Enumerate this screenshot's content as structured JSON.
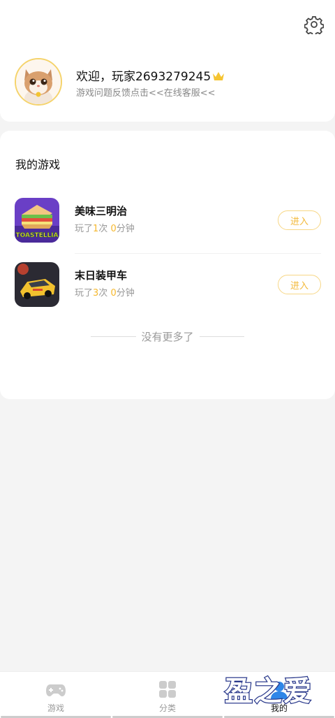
{
  "profile": {
    "welcome": "欢迎，玩家2693279245",
    "feedback": "游戏问题反馈点击<<在线客服<<"
  },
  "my_games": {
    "title": "我的游戏",
    "items": [
      {
        "name": "美味三明治",
        "played_prefix": "玩了",
        "play_count": "1",
        "count_unit": "次",
        "minutes": "0",
        "minutes_unit": "分钟",
        "button": "进入",
        "icon": "sandwich-game-icon",
        "icon_text": "TOASTELLIA"
      },
      {
        "name": "末日装甲车",
        "played_prefix": "玩了",
        "play_count": "3",
        "count_unit": "次",
        "minutes": "0",
        "minutes_unit": "分钟",
        "button": "进入",
        "icon": "armored-car-game-icon"
      }
    ],
    "no_more": "没有更多了"
  },
  "tabbar": {
    "tabs": [
      {
        "label": "游戏",
        "icon": "gamepad-icon"
      },
      {
        "label": "分类",
        "icon": "grid-icon"
      },
      {
        "label": "我的",
        "icon": "user-icon"
      }
    ],
    "active": 2
  },
  "watermark": "盈之爱",
  "colors": {
    "accent": "#f5b82e",
    "button_border": "#f7d786",
    "crown": "#f5c431"
  }
}
